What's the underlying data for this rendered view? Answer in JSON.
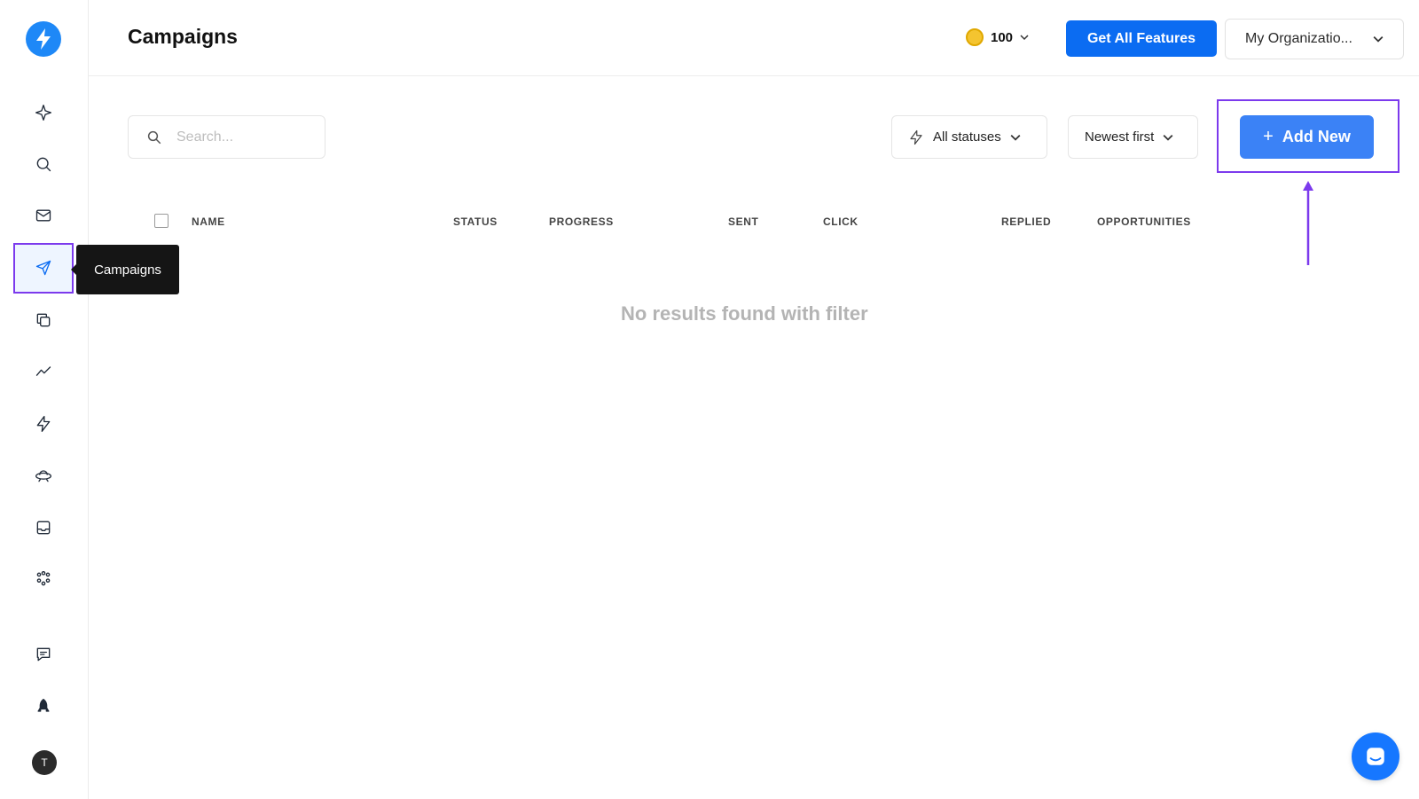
{
  "header": {
    "title": "Campaigns",
    "credits": "100",
    "cta_label": "Get All Features",
    "org_label": "My Organizatio..."
  },
  "sidebar": {
    "tooltip": "Campaigns",
    "avatar_initial": "T",
    "active_item": "campaigns"
  },
  "toolbar": {
    "search_placeholder": "Search...",
    "status_filter": "All statuses",
    "sort": "Newest first",
    "add_label": "Add New"
  },
  "table": {
    "columns": [
      "NAME",
      "STATUS",
      "PROGRESS",
      "SENT",
      "CLICK",
      "REPLIED",
      "OPPORTUNITIES"
    ],
    "empty_message": "No results found with filter"
  },
  "colors": {
    "accent": "#0b6cf2",
    "add_button": "#3b82f6",
    "highlight": "#7c3aed"
  }
}
